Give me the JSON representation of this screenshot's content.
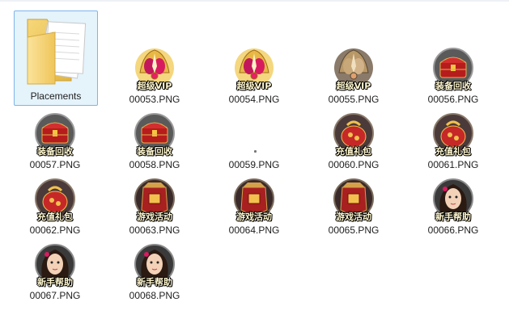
{
  "folder": {
    "name": "Placements",
    "icon": "folder-icon"
  },
  "files": [
    {
      "name": "00053.PNG",
      "caption": "超级VIP",
      "art": "crown-gold"
    },
    {
      "name": "00054.PNG",
      "caption": "超级VIP",
      "art": "crown-gold"
    },
    {
      "name": "00055.PNG",
      "caption": "超级VIP",
      "art": "crown-dark"
    },
    {
      "name": "00056.PNG",
      "caption": "装备回收",
      "art": "chest"
    },
    {
      "name": "00057.PNG",
      "caption": "装备回收",
      "art": "chest"
    },
    {
      "name": "00058.PNG",
      "caption": "装备回收",
      "art": "chest"
    },
    {
      "name": "00059.PNG",
      "caption": "",
      "art": "empty"
    },
    {
      "name": "00060.PNG",
      "caption": "充值礼包",
      "art": "giftbag"
    },
    {
      "name": "00061.PNG",
      "caption": "充值礼包",
      "art": "giftbag"
    },
    {
      "name": "00062.PNG",
      "caption": "充值礼包",
      "art": "giftbag"
    },
    {
      "name": "00063.PNG",
      "caption": "游戏活动",
      "art": "armor"
    },
    {
      "name": "00064.PNG",
      "caption": "游戏活动",
      "art": "armor"
    },
    {
      "name": "00065.PNG",
      "caption": "游戏活动",
      "art": "armor"
    },
    {
      "name": "00066.PNG",
      "caption": "新手帮助",
      "art": "girl"
    },
    {
      "name": "00067.PNG",
      "caption": "新手帮助",
      "art": "girl"
    },
    {
      "name": "00068.PNG",
      "caption": "新手帮助",
      "art": "girl"
    }
  ],
  "colors": {
    "selection_bg": "#e5f3fb",
    "selection_border": "#7eb4ea"
  }
}
